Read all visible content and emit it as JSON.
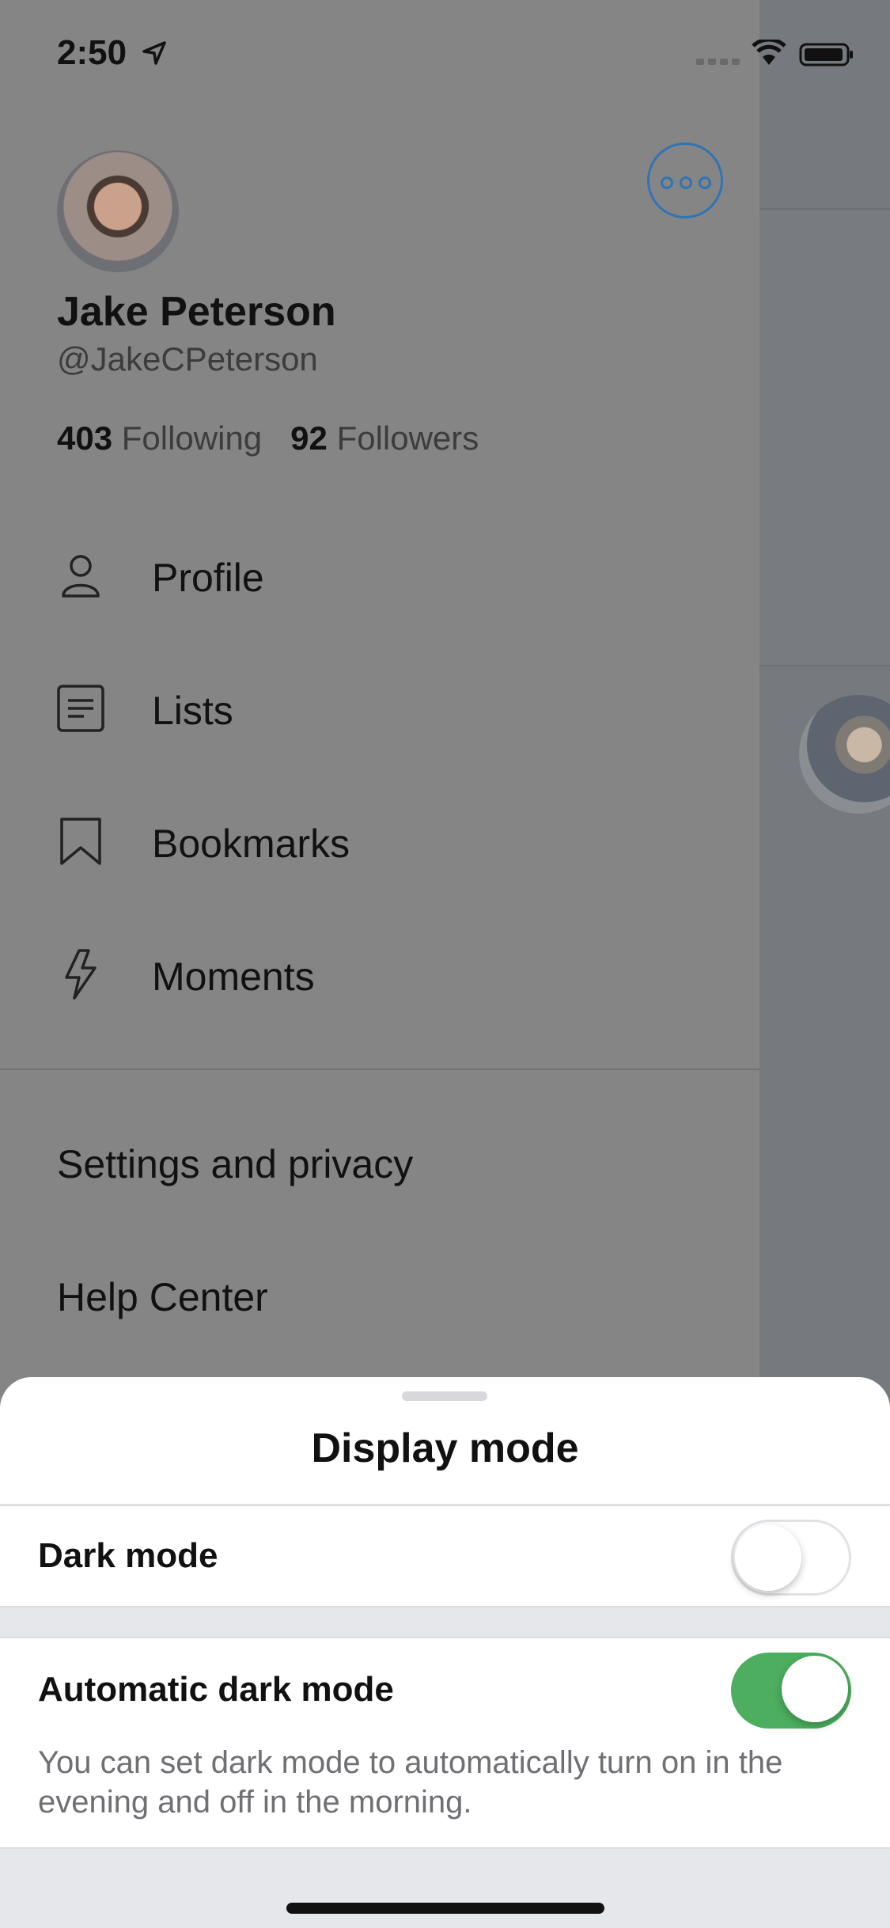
{
  "status_bar": {
    "time": "2:50"
  },
  "profile": {
    "name": "Jake Peterson",
    "handle": "@JakeCPeterson",
    "following_count": "403",
    "following_label": "Following",
    "followers_count": "92",
    "followers_label": "Followers"
  },
  "menu": {
    "items": [
      {
        "label": "Profile",
        "icon": "person-icon"
      },
      {
        "label": "Lists",
        "icon": "list-icon"
      },
      {
        "label": "Bookmarks",
        "icon": "bookmark-icon"
      },
      {
        "label": "Moments",
        "icon": "lightning-icon"
      }
    ],
    "settings_label": "Settings and privacy",
    "help_label": "Help Center"
  },
  "display_sheet": {
    "title": "Display mode",
    "dark_mode_label": "Dark mode",
    "dark_mode_enabled": false,
    "auto_dark_label": "Automatic dark mode",
    "auto_dark_enabled": true,
    "auto_dark_description": "You can set dark mode to automatically turn on in the evening and off in the morning."
  },
  "colors": {
    "accent_blue": "#2f74b4",
    "toggle_on_green": "#4cae5e"
  }
}
